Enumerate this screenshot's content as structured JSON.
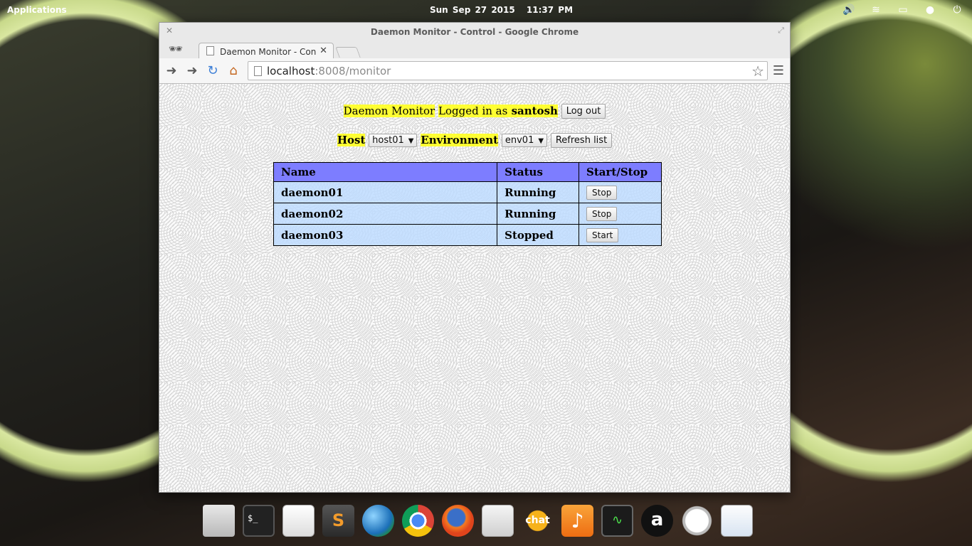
{
  "top_panel": {
    "applications": "Applications",
    "date": "Sun Sep 27 2015",
    "time": "11:37 PM",
    "tray_icons": [
      "volume-icon",
      "wifi-icon",
      "battery-icon",
      "notification-bell-icon",
      "power-icon"
    ]
  },
  "window": {
    "title": "Daemon Monitor - Control - Google Chrome",
    "tab_title": "Daemon Monitor - Control",
    "url_host": "localhost",
    "url_rest": ":8008/monitor"
  },
  "page": {
    "app_name": "Daemon Monitor",
    "logged_in_prefix": "Logged in as",
    "username": "santosh",
    "logout_label": "Log out",
    "host_label": "Host",
    "host_value": "host01",
    "environment_label": "Environment",
    "environment_value": "env01",
    "refresh_label": "Refresh list",
    "table": {
      "headers": [
        "Name",
        "Status",
        "Start/Stop"
      ],
      "rows": [
        {
          "name": "daemon01",
          "status": "Running",
          "action": "Stop"
        },
        {
          "name": "daemon02",
          "status": "Running",
          "action": "Stop"
        },
        {
          "name": "daemon03",
          "status": "Stopped",
          "action": "Start"
        }
      ]
    }
  },
  "dock": {
    "items": [
      "files",
      "terminal",
      "text-editor",
      "sublime-text",
      "browser-globe",
      "chrome",
      "firefox",
      "settings-switch",
      "xchat",
      "music",
      "system-monitor",
      "amazon",
      "clock-check",
      "presentation"
    ]
  },
  "colors": {
    "highlight": "#ffff33",
    "table_header": "#7d7dff",
    "table_row": "#bedcff"
  }
}
